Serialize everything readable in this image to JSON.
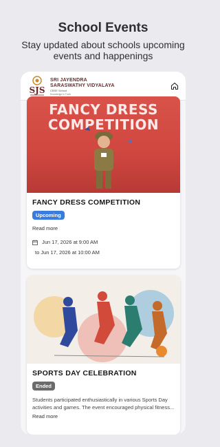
{
  "promo": {
    "title": "School Events",
    "subtitle": "Stay updated about schools upcoming events and happenings"
  },
  "header": {
    "school_name_line1": "SRI JAYENDRA",
    "school_name_line2": "SARASWATHY VIDYALAYA",
    "school_affiliation": "CBSE School",
    "motto": "Knowledge is Truth",
    "home_icon": "home-icon"
  },
  "events": [
    {
      "title": "FANCY DRESS COMPETITION",
      "image_text_line1": "FANCY DRESS",
      "image_text_line2": "COMPETITION",
      "status": "Upcoming",
      "read_more": "Read more",
      "start": "Jun 17, 2026 at 9:00 AM",
      "end": "to Jun 17, 2026 at 10:00 AM"
    },
    {
      "title": "SPORTS DAY CELEBRATION",
      "status": "Ended",
      "description": "Students participated enthusiastically in various Sports Day activities and games. The event encouraged physical fitness...",
      "read_more": "Read more"
    }
  ],
  "colors": {
    "background": "#ebeaef",
    "upcoming_badge": "#3a7be0",
    "ended_badge": "#6b6b6b",
    "fancy_dress_bg": "#d9534a"
  }
}
